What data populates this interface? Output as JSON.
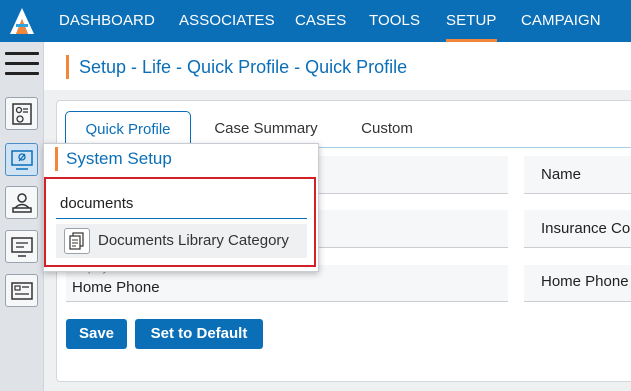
{
  "nav": {
    "items": [
      {
        "label": "DASHBOARD"
      },
      {
        "label": "ASSOCIATES"
      },
      {
        "label": "CASES"
      },
      {
        "label": "TOOLS"
      },
      {
        "label": "SETUP"
      },
      {
        "label": "CAMPAIGN"
      }
    ],
    "active": "SETUP"
  },
  "rail": {
    "icons": [
      "menu-icon",
      "profile-settings-icon",
      "system-setup-icon",
      "user-desk-icon",
      "monitor-icon",
      "card-layout-icon"
    ]
  },
  "page": {
    "title": "Setup - Life - Quick Profile - Quick Profile"
  },
  "tabs": [
    {
      "label": "Quick Profile"
    },
    {
      "label": "Case Summary"
    },
    {
      "label": "Custom"
    }
  ],
  "fields": {
    "right_col": [
      {
        "value": "Name"
      },
      {
        "value": "Insurance Co"
      },
      {
        "value": "Home Phone"
      }
    ],
    "display_name_label": "Display Name",
    "display_name_value": "Home Phone"
  },
  "buttons": {
    "save": "Save",
    "set_default": "Set to Default"
  },
  "popup": {
    "title": "System Setup",
    "search_value": "documents",
    "results": [
      {
        "label": "Documents Library Category",
        "icon": "documents-icon"
      }
    ]
  },
  "colors": {
    "primary": "#0b6fb8",
    "accent": "#f0873a",
    "highlight": "#d32027"
  }
}
